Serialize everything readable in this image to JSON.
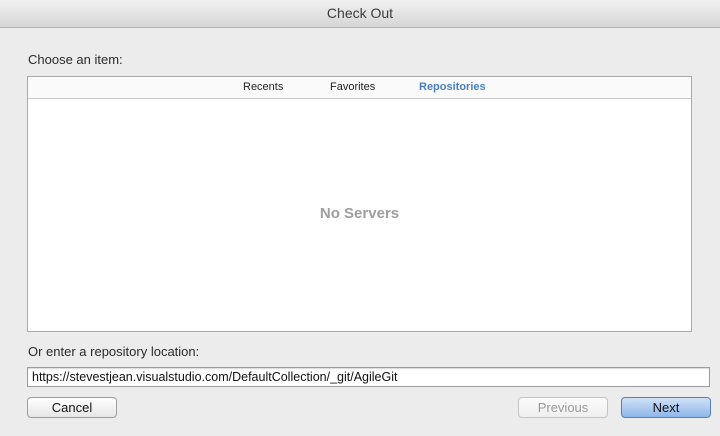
{
  "window": {
    "title": "Check Out"
  },
  "picker": {
    "label": "Choose an item:",
    "tabs": [
      {
        "label": "Recents",
        "active": false
      },
      {
        "label": "Favorites",
        "active": false
      },
      {
        "label": "Repositories",
        "active": true
      }
    ],
    "empty_message": "No Servers"
  },
  "location": {
    "label": "Or enter a repository location:",
    "value": "https://stevestjean.visualstudio.com/DefaultCollection/_git/AgileGit"
  },
  "buttons": {
    "cancel": "Cancel",
    "previous": "Previous",
    "next": "Next"
  },
  "colors": {
    "active_tab": "#4a7fc1",
    "default_button": "#8fb6ea"
  }
}
